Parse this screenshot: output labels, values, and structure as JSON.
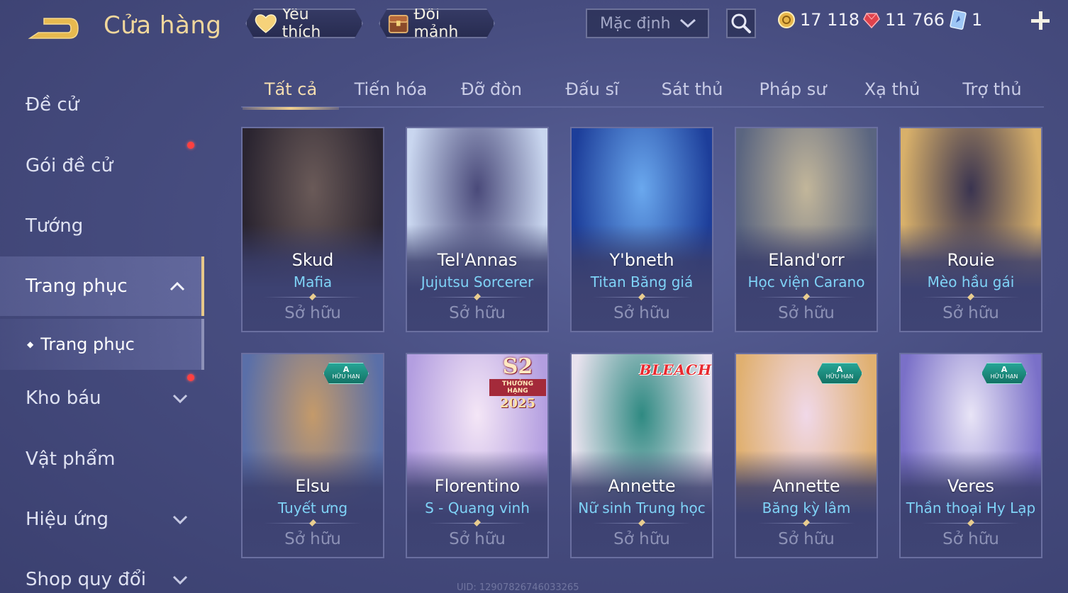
{
  "header": {
    "title": "Cửa hàng",
    "favorites_label": "Yêu thích",
    "shards_label": "Đổi mảnh",
    "sort_value": "Mặc định"
  },
  "currencies": {
    "gold": "17 118",
    "gems": "11 766",
    "tickets": "1"
  },
  "sidebar": {
    "items": [
      {
        "label": "Đề cử"
      },
      {
        "label": "Gói đề cử"
      },
      {
        "label": "Tướng"
      },
      {
        "label": "Trang phục"
      },
      {
        "label": "Kho báu"
      },
      {
        "label": "Vật phẩm"
      },
      {
        "label": "Hiệu ứng"
      },
      {
        "label": "Shop quy đổi"
      }
    ],
    "sub_item": "Trang phục"
  },
  "tabs": [
    "Tất cả",
    "Tiến hóa",
    "Đỡ đòn",
    "Đấu sĩ",
    "Sát thủ",
    "Pháp sư",
    "Xạ thủ",
    "Trợ thủ"
  ],
  "cards": [
    {
      "hero": "Skud",
      "skin": "Mafia",
      "status": "Sở hữu",
      "colors": [
        "#2a2430",
        "#6a5a58"
      ]
    },
    {
      "hero": "Tel'Annas",
      "skin": "Jujutsu Sorcerer",
      "status": "Sở hữu",
      "colors": [
        "#c9d6ef",
        "#4a4a7a"
      ]
    },
    {
      "hero": "Y'bneth",
      "skin": "Titan Băng giá",
      "status": "Sở hữu",
      "colors": [
        "#1d3e9a",
        "#6aa8ee"
      ]
    },
    {
      "hero": "Eland'orr",
      "skin": "Học viện Carano",
      "status": "Sở hữu",
      "colors": [
        "#5a6580",
        "#c2b69a"
      ]
    },
    {
      "hero": "Rouie",
      "skin": "Mèo hầu gái",
      "status": "Sở hữu",
      "colors": [
        "#d8b06a",
        "#3a3450"
      ]
    },
    {
      "hero": "Elsu",
      "skin": "Tuyết ưng",
      "status": "Sở hữu",
      "colors": [
        "#5a6fa8",
        "#c49a6a"
      ],
      "badge": "limited"
    },
    {
      "hero": "Florentino",
      "skin": "S - Quang vinh",
      "status": "Sở hữu",
      "colors": [
        "#b39ee0",
        "#f4e6f6"
      ],
      "badge": "rank"
    },
    {
      "hero": "Annette",
      "skin": "Nữ sinh Trung học",
      "status": "Sở hữu",
      "colors": [
        "#e8e2ee",
        "#2f8a82"
      ],
      "badge": "bleach"
    },
    {
      "hero": "Annette",
      "skin": "Băng kỳ lâm",
      "status": "Sở hữu",
      "colors": [
        "#e0b070",
        "#f0d8e8"
      ],
      "badge": "limited"
    },
    {
      "hero": "Veres",
      "skin": "Thần thoại Hy Lạp",
      "status": "Sở hữu",
      "colors": [
        "#7a70c8",
        "#e8e4f6"
      ],
      "badge": "limited"
    }
  ],
  "badges": {
    "limited_grade": "A",
    "limited_text": "HỮU HẠN",
    "rank_season": "S2",
    "rank_text": "THƯỞNG HẠNG",
    "rank_year": "2025",
    "bleach_text": "BLEACH"
  },
  "footer": {
    "uid": "UID: 12907826746033265"
  },
  "colors": {
    "accent_gold": "#f1d79c",
    "skin_name": "#7fd3f7",
    "notification": "#ff4040"
  }
}
